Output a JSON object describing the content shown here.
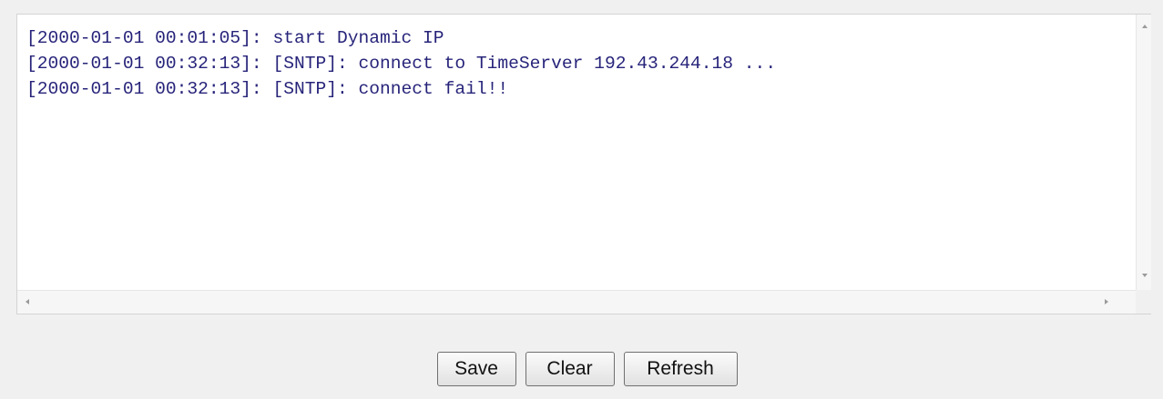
{
  "log": {
    "lines": [
      "[2000-01-01 00:01:05]: start Dynamic IP",
      "[2000-01-01 00:32:13]: [SNTP]: connect to TimeServer 192.43.244.18 ...",
      "[2000-01-01 00:32:13]: [SNTP]: connect fail!!"
    ]
  },
  "actions": {
    "save_label": "Save",
    "clear_label": "Clear",
    "refresh_label": "Refresh"
  },
  "icons": {
    "scroll_up": "triangle-up-icon",
    "scroll_down": "triangle-down-icon",
    "scroll_left": "triangle-left-icon",
    "scroll_right": "triangle-right-icon"
  },
  "colors": {
    "log_text": "#27247a",
    "page_background": "#f0f0f0",
    "panel_background": "#ffffff"
  }
}
